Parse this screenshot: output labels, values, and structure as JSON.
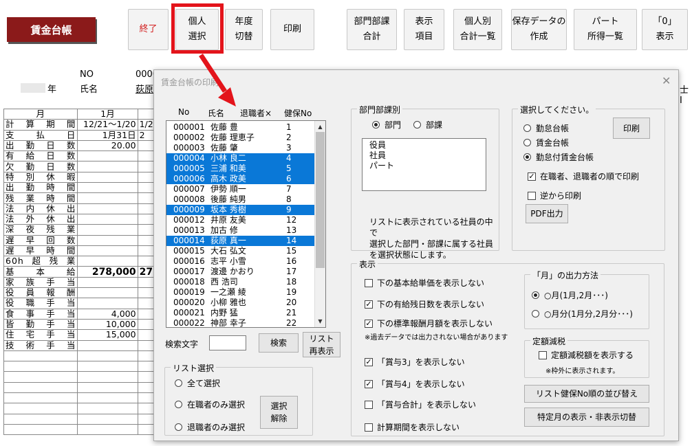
{
  "app": {
    "title": "賃金台帳"
  },
  "toolbar": [
    {
      "label": "終了",
      "red": true
    },
    {
      "label": "個人\n選択"
    },
    {
      "label": "年度\n切替"
    },
    {
      "label": "印刷"
    },
    {
      "label": "部門部課\n合計"
    },
    {
      "label": "表示\n項目"
    },
    {
      "label": "個人別\n合計一覧"
    },
    {
      "label": "保存データの\n作成"
    },
    {
      "label": "パート\n所得一覧"
    },
    {
      "label": "「0」\n表示"
    }
  ],
  "sheet": {
    "no_label": "NO",
    "no_value": "0000",
    "year_label": "年",
    "name_label": "氏名",
    "name_value": "荻原",
    "right_fragment": "士 I",
    "month_header": "月",
    "month_col": "1月",
    "rows": [
      {
        "label": "計算期間",
        "v1": "12/21～1/20",
        "v2": "1/2"
      },
      {
        "label": "支払日",
        "v1": "1月31日",
        "v2": "2"
      },
      {
        "label": "出勤日数",
        "v1": "20.00",
        "v2": ""
      },
      {
        "label": "有給日数",
        "v1": "",
        "v2": ""
      },
      {
        "label": "欠勤日数",
        "v1": "",
        "v2": ""
      },
      {
        "label": "特別休暇",
        "v1": "",
        "v2": ""
      },
      {
        "label": "出勤時間",
        "v1": "",
        "v2": ""
      },
      {
        "label": "残業時間",
        "v1": "",
        "v2": ""
      },
      {
        "label": "法内休出",
        "v1": "",
        "v2": ""
      },
      {
        "label": "法外休出",
        "v1": "",
        "v2": ""
      },
      {
        "label": "深夜残業",
        "v1": "",
        "v2": ""
      },
      {
        "label": "遅早回数",
        "v1": "",
        "v2": ""
      },
      {
        "label": "遅早時間",
        "v1": "",
        "v2": ""
      },
      {
        "label": "60h超残業",
        "v1": "",
        "v2": ""
      },
      {
        "label": "基本給",
        "v1": "278,000",
        "v2": "27",
        "bold": true
      },
      {
        "label": "家族手当",
        "v1": "",
        "v2": ""
      },
      {
        "label": "役員報酬",
        "v1": "",
        "v2": ""
      },
      {
        "label": "役職手当",
        "v1": "",
        "v2": ""
      },
      {
        "label": "食事手当",
        "v1": "4,000",
        "v2": ""
      },
      {
        "label": "皆勤手当",
        "v1": "10,000",
        "v2": ""
      },
      {
        "label": "住宅手当",
        "v1": "15,000",
        "v2": ""
      },
      {
        "label": "技術手当",
        "v1": "",
        "v2": ""
      },
      {
        "label": "",
        "v1": "",
        "v2": ""
      },
      {
        "label": "",
        "v1": "",
        "v2": ""
      },
      {
        "label": "",
        "v1": "",
        "v2": ""
      },
      {
        "label": "",
        "v1": "",
        "v2": ""
      },
      {
        "label": "",
        "v1": "",
        "v2": ""
      },
      {
        "label": "",
        "v1": "",
        "v2": ""
      },
      {
        "label": "",
        "v1": "",
        "v2": ""
      },
      {
        "label": "",
        "v1": "",
        "v2": ""
      }
    ]
  },
  "dialog": {
    "title": "賃金台帳の印刷",
    "close": "✕",
    "list_headers": {
      "no": "No",
      "name": "氏名",
      "retired": "退職者×",
      "insurance": "健保No"
    },
    "employees": [
      {
        "no": "000001",
        "name": "佐藤 豊",
        "hno": "1",
        "sel": false
      },
      {
        "no": "000002",
        "name": "佐藤 理恵子",
        "hno": "2",
        "sel": false
      },
      {
        "no": "000003",
        "name": "佐藤 肇",
        "hno": "3",
        "sel": false
      },
      {
        "no": "000004",
        "name": "小林 良二",
        "hno": "4",
        "sel": true
      },
      {
        "no": "000005",
        "name": "三浦 和美",
        "hno": "5",
        "sel": true
      },
      {
        "no": "000006",
        "name": "高木 政美",
        "hno": "6",
        "sel": true
      },
      {
        "no": "000007",
        "name": "伊勢 順一",
        "hno": "7",
        "sel": false
      },
      {
        "no": "000008",
        "name": "後藤 純男",
        "hno": "8",
        "sel": false
      },
      {
        "no": "000009",
        "name": "坂本 秀樹",
        "hno": "9",
        "sel": true
      },
      {
        "no": "000012",
        "name": "井原 友美",
        "hno": "12",
        "sel": false
      },
      {
        "no": "000013",
        "name": "加古 修",
        "hno": "13",
        "sel": false
      },
      {
        "no": "000014",
        "name": "荻原 真一",
        "hno": "14",
        "sel": true
      },
      {
        "no": "000015",
        "name": "大石 弘文",
        "hno": "15",
        "sel": false
      },
      {
        "no": "000016",
        "name": "志平 小雪",
        "hno": "16",
        "sel": false
      },
      {
        "no": "000017",
        "name": "渡邊 かおり",
        "hno": "17",
        "sel": false
      },
      {
        "no": "000018",
        "name": "西 浩司",
        "hno": "18",
        "sel": false
      },
      {
        "no": "000019",
        "name": "一之瀬 綾",
        "hno": "19",
        "sel": false
      },
      {
        "no": "000020",
        "name": "小柳 雅也",
        "hno": "20",
        "sel": false
      },
      {
        "no": "000021",
        "name": "内野 猛",
        "hno": "21",
        "sel": false
      },
      {
        "no": "000022",
        "name": "神部 幸子",
        "hno": "22",
        "sel": false
      }
    ],
    "search": {
      "label": "検索文字",
      "button": "検索",
      "relist": "リスト\n再表示"
    },
    "list_select": {
      "legend": "リスト選択",
      "all": "全て選択",
      "active": "在職者のみ選択",
      "retired": "退職者のみ選択",
      "clear": "選択\n解除"
    },
    "dept": {
      "legend": "部門部課別",
      "opt_dept": "部門",
      "opt_section": "部課",
      "items": [
        "役員",
        "社員",
        "パート"
      ],
      "note": "リストに表示されている社員の中で\n選択した部門・部課に属する社員\nを選択状態にします。"
    },
    "choose": {
      "legend": "選択してください。",
      "opt1": "勤怠台帳",
      "opt2": "賃金台帳",
      "opt3": "勤怠付賃金台帳",
      "print": "印刷",
      "chk_order": "在職者、退職者の順で印刷",
      "chk_reverse": "逆から印刷",
      "pdf": "PDF出力"
    },
    "display": {
      "legend": "表示",
      "c1": "下の基本給単価を表示しない",
      "c2": "下の有給残日数を表示しない",
      "c3": "下の標準報酬月額を表示しない",
      "note": "※過去データでは出力されない場合があります",
      "c4": "「賞与3」を表示しない",
      "c5": "「賞与4」を表示しない",
      "c6": "「賞与合計」を表示しない",
      "c7": "計算期間を表示しない"
    },
    "month_output": {
      "legend": "「月」の出力方法",
      "o1": "○月(1月,2月･･･)",
      "o2": "○月分(1月分,2月分･･･)"
    },
    "fixed_tax": {
      "legend": "定額減税",
      "chk": "定額減税額を表示する",
      "note": "※枠外に表示されます。"
    },
    "sort_button": "リスト健保No順の並び替え",
    "special_button": "特定月の表示・非表示切替"
  }
}
